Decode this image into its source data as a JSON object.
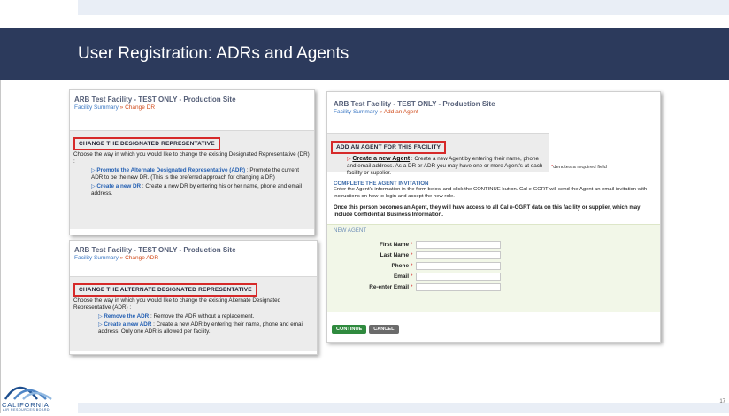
{
  "slide": {
    "title": "User Registration: ADRs and Agents",
    "number": "17"
  },
  "logo": {
    "name": "CALIFORNIA",
    "subtitle": "AIR RESOURCES BOARD"
  },
  "shot_dr": {
    "site": "ARB Test Facility - TEST ONLY - Production Site",
    "crumb_link": "Facility Summary",
    "crumb_sep": " » ",
    "crumb_current": "Change DR",
    "heading": "CHANGE THE DESIGNATED REPRESENTATIVE",
    "description": "Choose the way in which you would like to change the existing Designated Representative (DR) :",
    "options": [
      {
        "link": "Promote the Alternate Designated Representative (ADR)",
        "text": " : Promote the current ADR to be the new DR. (This is the preferred approach for changing a DR)"
      },
      {
        "link": "Create a new DR",
        "text": " : Create a new DR by entering his or her name, phone and email address."
      }
    ]
  },
  "shot_adr": {
    "site": "ARB Test Facility - TEST ONLY - Production Site",
    "crumb_link": "Facility Summary",
    "crumb_sep": " » ",
    "crumb_current": "Change ADR",
    "heading": "CHANGE THE ALTERNATE DESIGNATED REPRESENTATIVE",
    "description": "Choose the way in which you would like to change the existing Alternate Designated Representative (ADR) :",
    "options": [
      {
        "link": "Remove the ADR",
        "text": " : Remove the ADR without a replacement."
      },
      {
        "link": "Create a new ADR",
        "text": " : Create a new ADR by entering their name, phone and email address.  Only one ADR is allowed per facility."
      }
    ]
  },
  "shot_agent": {
    "site": "ARB Test Facility - TEST ONLY - Production Site",
    "crumb_link": "Facility Summary",
    "crumb_sep": " » ",
    "crumb_current": "Add an Agent",
    "heading": "ADD AN AGENT FOR THIS FACILITY",
    "create_link": "Create a new Agent",
    "create_text": " : Create a new Agent by entering their name, phone and email address.  As a DR or ADR you may have one or more Agent's at each facility or supplier.",
    "required_note": "denotes a required field",
    "invite_heading": "COMPLETE THE AGENT INVITATION",
    "invite_text": "Enter the Agent's information in the form below and click the CONTINUE button. Cal e-GGRT will send the Agent an email invitation with instructions on how to login and accept the new role.",
    "access_note": "Once this person becomes an Agent, they will have access to all Cal e-GGRT data on this facility or supplier, which may include Confidential Business Information.",
    "form_heading": "NEW AGENT",
    "fields": [
      {
        "label": "First Name"
      },
      {
        "label": "Last Name"
      },
      {
        "label": "Phone"
      },
      {
        "label": "Email"
      },
      {
        "label": "Re-enter Email"
      }
    ],
    "continue_label": "CONTINUE",
    "cancel_label": "CANCEL"
  }
}
